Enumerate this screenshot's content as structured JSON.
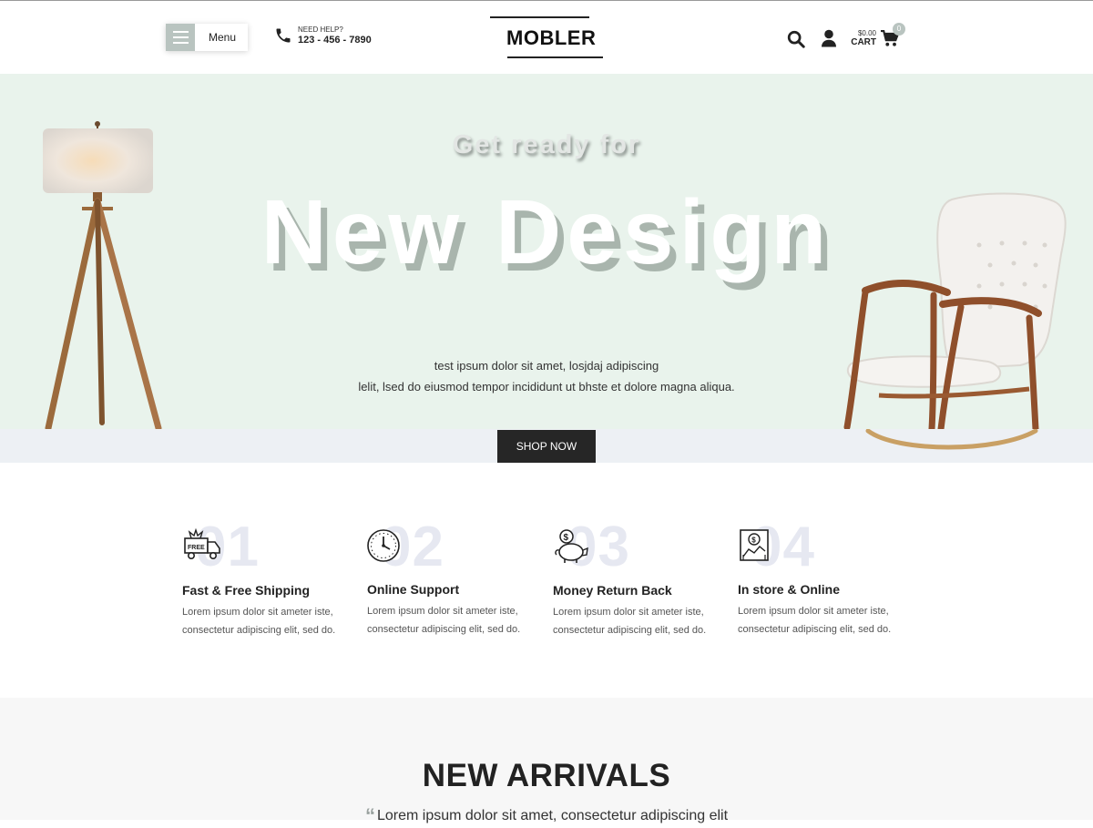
{
  "header": {
    "menu_label": "Menu",
    "help_label": "NEED HELP?",
    "phone": "123 - 456 - 7890",
    "logo": "MOBLER",
    "cart_amount": "$0.00",
    "cart_label": "CART",
    "cart_count": "0",
    "icons": [
      "hamburger-icon",
      "phone-icon",
      "search-icon",
      "user-icon",
      "cart-icon"
    ]
  },
  "hero": {
    "sub_heading": "Get ready for",
    "heading": "New Design",
    "text_line1": "test ipsum dolor sit amet, losjdaj adipiscing",
    "text_line2": "lelit, lsed do eiusmod tempor incididunt ut bhste et dolore magna aliqua.",
    "button": "SHOP NOW"
  },
  "features": [
    {
      "number": "01",
      "title": "Fast & Free Shipping",
      "icon": "free-delivery-truck-icon",
      "line1": "Lorem ipsum dolor sit ameter iste,",
      "line2": "consectetur adipiscing elit, sed do."
    },
    {
      "number": "02",
      "title": "Online Support",
      "icon": "clock-icon",
      "line1": "Lorem ipsum dolor sit ameter iste,",
      "line2": "consectetur adipiscing elit, sed do."
    },
    {
      "number": "03",
      "title": "Money Return Back",
      "icon": "piggy-bank-icon",
      "line1": "Lorem ipsum dolor sit ameter iste,",
      "line2": "consectetur adipiscing elit, sed do."
    },
    {
      "number": "04",
      "title": "In store & Online",
      "icon": "store-online-icon",
      "line1": "Lorem ipsum dolor sit ameter iste,",
      "line2": "consectetur adipiscing elit, sed do."
    }
  ],
  "arrivals": {
    "title": "NEW ARRIVALS",
    "subtitle": "Lorem ipsum dolor sit amet, consectetur adipiscing elit"
  },
  "colors": {
    "hero_bg": "#e9f3ec",
    "accent": "#b9c4c0",
    "button_bg": "#262626"
  }
}
